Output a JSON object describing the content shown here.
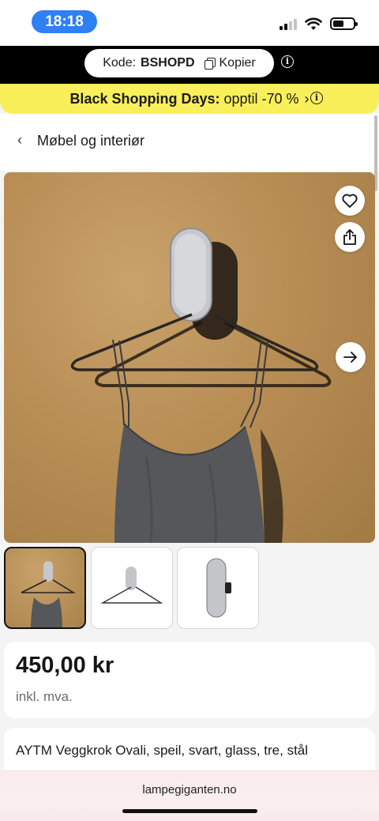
{
  "status_bar": {
    "time": "18:18",
    "time_pill_color": "#2f7ff5",
    "signal_bars_active": 2,
    "signal_bars_total": 4
  },
  "promo_code": {
    "label": "Kode:",
    "code": "BSHOPD",
    "copy_label": "Kopier"
  },
  "banner": {
    "bold_text": "Black Shopping Days:",
    "text": "opptil -70 %",
    "chevron": "›",
    "color": "#f9ef5a"
  },
  "breadcrumb": {
    "back_icon": "‹",
    "label": "Møbel og interiør"
  },
  "gallery": {
    "main_image": "product-photo-mirror-hook-with-hanger-and-top",
    "thumbnails": [
      {
        "name": "thumb-lifestyle",
        "active": true
      },
      {
        "name": "thumb-hanger",
        "active": false
      },
      {
        "name": "thumb-mirror-side",
        "active": false
      }
    ],
    "icons": [
      "heart-icon",
      "share-icon",
      "arrow-right-icon"
    ]
  },
  "product": {
    "price": "450,00 kr",
    "price_note": "inkl. mva.",
    "title": "AYTM Veggkrok Ovali, speil, svart, glass, tre, stål"
  },
  "browser": {
    "url": "lampegiganten.no"
  }
}
